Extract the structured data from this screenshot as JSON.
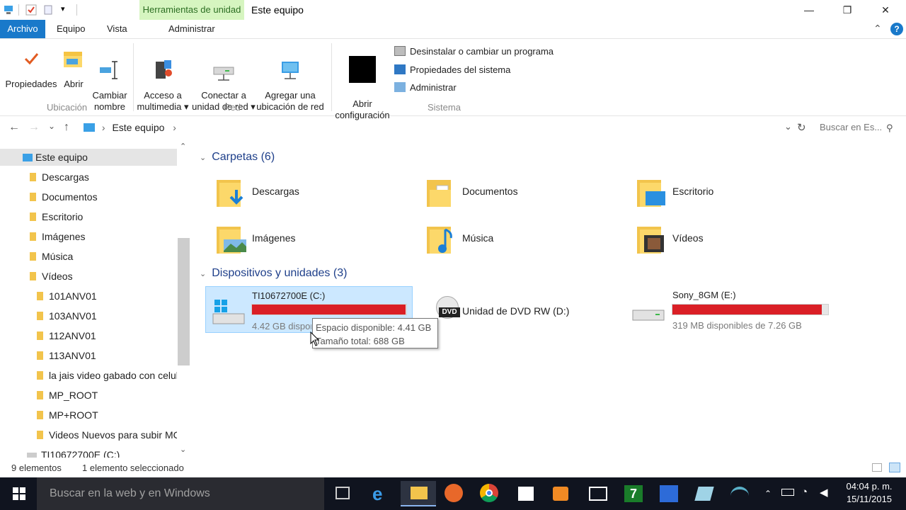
{
  "window": {
    "context_tab": "Herramientas de unidad",
    "title": "Este equipo",
    "minimize_glyph": "—",
    "maximize_glyph": "❐",
    "close_glyph": "✕"
  },
  "ribbon_tabs": [
    "Archivo",
    "Equipo",
    "Vista",
    "Administrar"
  ],
  "ribbon": {
    "ubicacion": {
      "label": "Ubicación",
      "buttons": [
        "Propiedades",
        "Abrir",
        "Cambiar\nnombre"
      ]
    },
    "red": {
      "label": "Red",
      "buttons": [
        "Acceso a\nmultimedia ▾",
        "Conectar a\nunidad de red ▾",
        "Agregar una\nubicación de red"
      ]
    },
    "sistema": {
      "label": "Sistema",
      "open_config": "Abrir\nconfiguración",
      "items": [
        "Desinstalar o cambiar un programa",
        "Propiedades del sistema",
        "Administrar"
      ]
    }
  },
  "address": {
    "back": "←",
    "forward": "→",
    "recent": "⌄",
    "up": "↑",
    "breadcrumb": "Este equipo",
    "sep": "›",
    "dropdown": "⌄",
    "refresh": "↻",
    "search_placeholder": "Buscar en Es..."
  },
  "sidebar": {
    "root": "Este equipo",
    "items": [
      "Descargas",
      "Documentos",
      "Escritorio",
      "Imágenes",
      "Música",
      "Vídeos"
    ],
    "video_subfolders": [
      "101ANV01",
      "103ANV01",
      "112ANV01",
      "113ANV01",
      "la jais video gabado con celul",
      "MP_ROOT",
      "MP+ROOT",
      "Videos Nuevos para subir MC"
    ],
    "last_item": "TI10672700E (C:)"
  },
  "content": {
    "folders_header": "Carpetas (6)",
    "folders": [
      "Descargas",
      "Documentos",
      "Escritorio",
      "Imágenes",
      "Música",
      "Vídeos"
    ],
    "devices_header": "Dispositivos y unidades (3)",
    "drives": [
      {
        "name": "TI10672700E (C:)",
        "sub": "4.42 GB disponibles de 688 GB",
        "used_fraction": 0.994
      },
      {
        "name": "Unidad de DVD RW (D:)"
      },
      {
        "name": "Sony_8GM (E:)",
        "sub": "319 MB disponibles de 7.26 GB",
        "used_fraction": 0.957
      }
    ],
    "dvd_label": "DVD"
  },
  "tooltip": {
    "line1": "Espacio disponible: 4.41 GB",
    "line2": "Tamaño total: 688 GB"
  },
  "status": {
    "count": "9 elementos",
    "selected": "1 elemento seleccionado"
  },
  "taskbar": {
    "search": "Buscar en la web y en Windows",
    "time": "04:04 p. m.",
    "date": "15/11/2015"
  },
  "colors": {
    "accent": "#1979ca",
    "drive_bar": "#da1f26",
    "context_tab_bg": "#d6f5c0",
    "section_text": "#1e3f8a",
    "taskbar": "#10141f"
  }
}
